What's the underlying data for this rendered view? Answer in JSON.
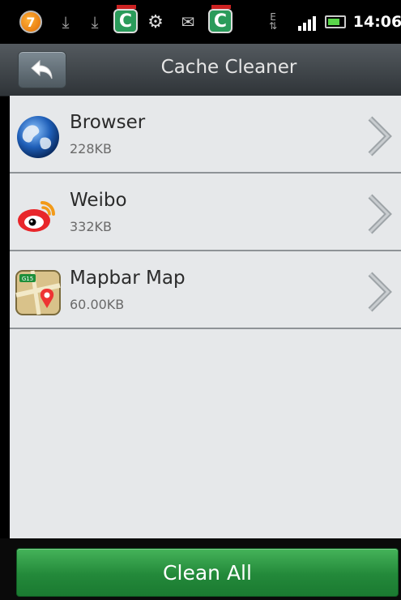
{
  "status_bar": {
    "notification_count": "7",
    "time": "14:06",
    "network_label": "E"
  },
  "header": {
    "title": "Cache Cleaner",
    "back_icon": "back-arrow-icon"
  },
  "apps": [
    {
      "name": "Browser",
      "size": "228KB",
      "icon": "globe-icon"
    },
    {
      "name": "Weibo",
      "size": "332KB",
      "icon": "weibo-icon"
    },
    {
      "name": "Mapbar Map",
      "size": "60.00KB",
      "icon": "map-icon"
    }
  ],
  "footer": {
    "clean_all_label": "Clean All"
  },
  "colors": {
    "accent_green": "#23893a",
    "title_bar": "#3f4549",
    "list_bg": "#e6e8ea"
  }
}
